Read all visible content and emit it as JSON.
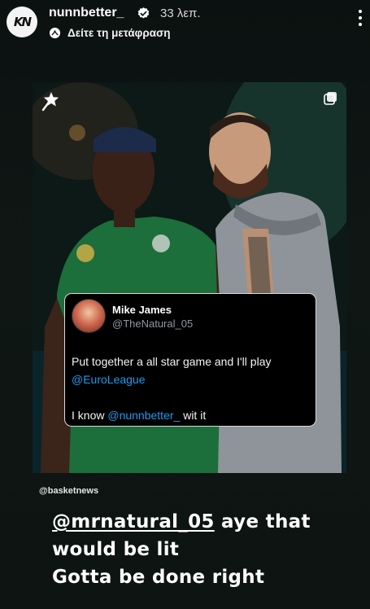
{
  "header": {
    "avatar_mark": "KN",
    "username": "nunnbetter_",
    "time": "33 λεπ.",
    "translate_label": "Δείτε τη μετάφραση"
  },
  "icons": {
    "verified": "verified-badge-icon",
    "translate": "translate-globe-icon",
    "more": "more-vertical-icon",
    "post_logo": "star-player-logo-icon",
    "carousel": "multiple-images-icon"
  },
  "tweet": {
    "name": "Mike James",
    "handle": "@TheNatural_05",
    "line1": "Put together a all star game and I'll play",
    "mention": "@EuroLeague",
    "line3_prefix": "I know ",
    "line3_mention": "@nunnbetter_",
    "line3_suffix": " wit it"
  },
  "credit": "@basketnews",
  "caption": {
    "mention": "@mrnatural_05",
    "line1_rest": " aye that",
    "line2": "would be lit",
    "line3": "Gotta be done right"
  },
  "colors": {
    "mention_blue": "#1d9bf0",
    "handle_gray": "#8b98a5",
    "background": "#0e1412"
  }
}
